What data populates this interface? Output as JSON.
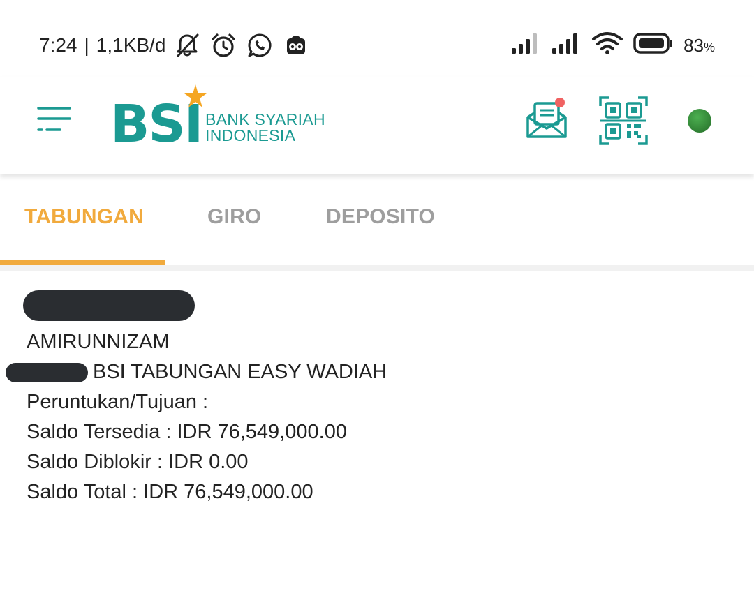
{
  "status_bar": {
    "time": "7:24",
    "separator": "|",
    "network_speed": "1,1KB/d",
    "left_icons": [
      "bell-off-icon",
      "alarm-clock-icon",
      "whatsapp-icon",
      "tripadvisor-icon"
    ],
    "right_icons": [
      "signal-1-icon",
      "signal-2-icon",
      "wifi-icon",
      "battery-icon"
    ],
    "battery_percent": "83",
    "battery_unit": "%"
  },
  "header": {
    "logo": {
      "mark": "BSI",
      "line1": "BANK SYARIAH",
      "line2": "INDONESIA"
    },
    "colors": {
      "brand_teal": "#1b9a92",
      "star_orange": "#f5a623",
      "notification_red": "#f06262",
      "status_green": "#3e9c40"
    }
  },
  "tabs": [
    {
      "label": "TABUNGAN",
      "active": true
    },
    {
      "label": "GIRO",
      "active": false
    },
    {
      "label": "DEPOSITO",
      "active": false
    }
  ],
  "account": {
    "name": "AMIRUNNIZAM",
    "product": "BSI TABUNGAN EASY WADIAH",
    "purpose": "Peruntukan/Tujuan :",
    "available": "Saldo Tersedia : IDR 76,549,000.00",
    "blocked": "Saldo Diblokir : IDR 0.00",
    "total": "Saldo Total : IDR 76,549,000.00"
  }
}
